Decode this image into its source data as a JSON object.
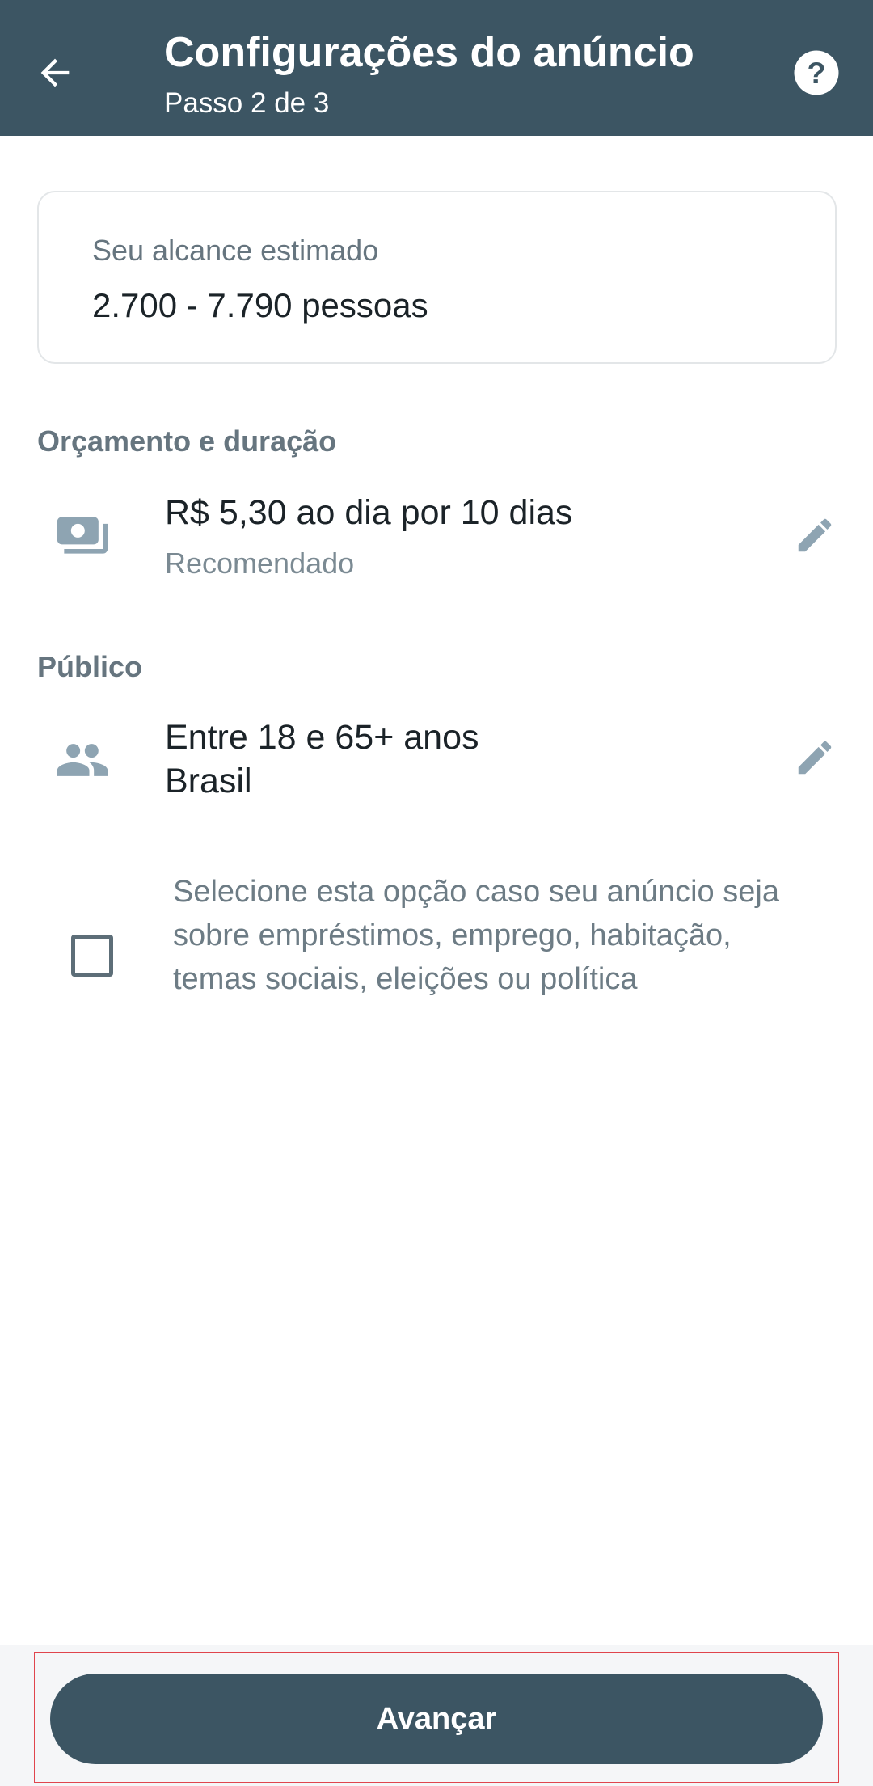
{
  "header": {
    "title": "Configurações do anúncio",
    "subtitle": "Passo 2 de 3",
    "back_icon": "arrow-left-icon",
    "help_icon": "help-circle-icon",
    "background_color": "#3c5563"
  },
  "reach": {
    "label": "Seu alcance estimado",
    "value": "2.700 - 7.790 pessoas"
  },
  "budget_section": {
    "header": "Orçamento e duração",
    "primary": "R$ 5,30 ao dia por 10 dias",
    "secondary": "Recomendado",
    "icon": "money-icon",
    "edit_icon": "pencil-icon"
  },
  "audience_section": {
    "header": "Público",
    "line1": "Entre 18 e 65+ anos",
    "line2": "Brasil",
    "icon": "people-icon",
    "edit_icon": "pencil-icon"
  },
  "special_category": {
    "checked": false,
    "text": "Selecione esta opção caso seu anúncio seja sobre empréstimos, emprego, habitação, temas sociais, eleições ou política"
  },
  "footer": {
    "button_label": "Avançar",
    "highlight_color": "#e0454d"
  }
}
